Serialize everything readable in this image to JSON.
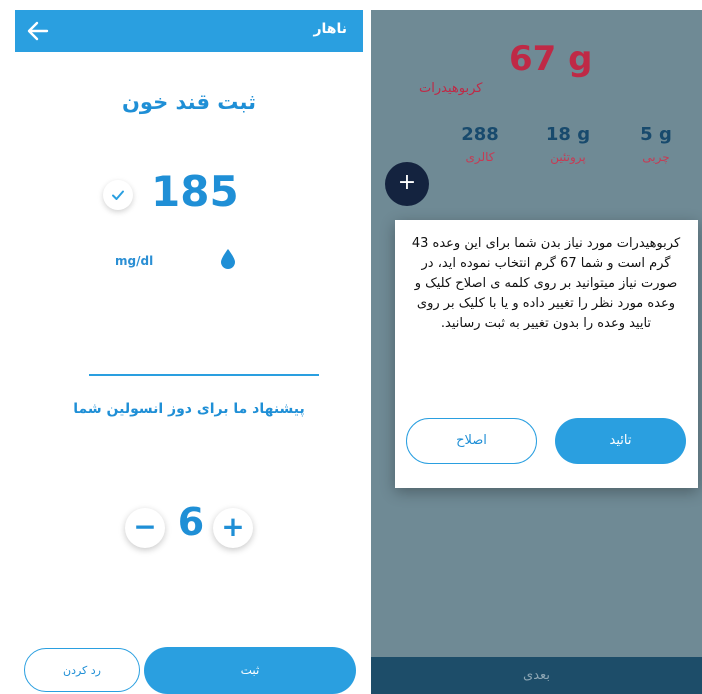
{
  "left_screen": {
    "header": {
      "title": "ناهار",
      "back_icon": "arrow-left-icon"
    },
    "glucose": {
      "title": "ثبت قند خون",
      "value": "185",
      "unit": "mg/dl",
      "check_icon": "check-icon",
      "drop_icon": "blood-drop-icon"
    },
    "insulin": {
      "suggestion": "پیشنهاد ما برای دوز انسولین شما",
      "dose": "6",
      "minus_label": "−",
      "plus_label": "+"
    },
    "actions": {
      "submit_label": "ثبت",
      "cancel_label": "رد کردن"
    }
  },
  "right_screen": {
    "carbs": {
      "value": "67 g",
      "label": "کربوهیدرات"
    },
    "stats": [
      {
        "value": "288",
        "label": "کالری"
      },
      {
        "value": "18 g",
        "label": "پروتئین"
      },
      {
        "value": "5 g",
        "label": "چربی"
      }
    ],
    "fab_label": "+",
    "dialog": {
      "message": "کربوهیدرات مورد نیاز بدن شما برای این وعده 43 گرم است و شما 67 گرم انتخاب نموده اید، در صورت نیاز میتوانید بر روی کلمه ی اصلاح کلیک و وعده مورد نظر را تغییر داده و یا با کلیک بر روی تایید وعده را بدون تغییر به ثبت رسانید.",
      "confirm_label": "تائید",
      "edit_label": "اصلاح"
    },
    "next_label": "بعدی"
  },
  "colors": {
    "primary": "#2a9fe0",
    "carb_red": "#bf2946",
    "overlay": "#6f8a95",
    "fab": "#14233f"
  }
}
